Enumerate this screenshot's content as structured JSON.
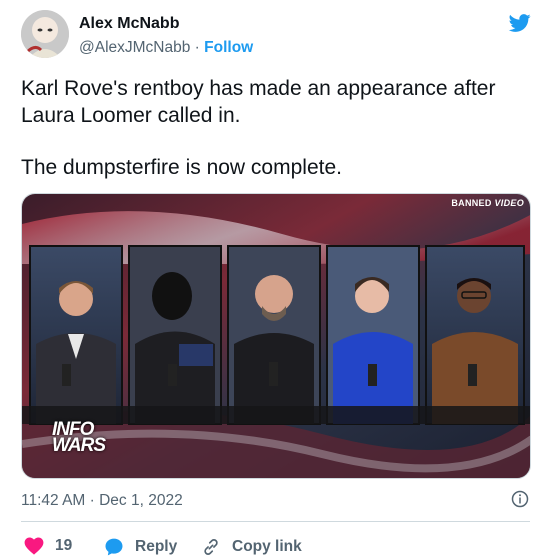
{
  "author": {
    "name": "Alex McNabb",
    "handle": "@AlexJMcNabb",
    "separator": " · ",
    "follow_label": "Follow"
  },
  "tweet": {
    "paragraphs": [
      "Karl Rove's rentboy has made an appearance after Laura Loomer called in.",
      "The dumpsterfire is now complete."
    ],
    "timestamp": "11:42 AM · Dec 1, 2022"
  },
  "media": {
    "watermark_main": "BANNED",
    "watermark_italic": "VIDEO",
    "logo_line1": "INFO",
    "logo_line2": "WARS"
  },
  "actions": {
    "like_count": "19",
    "reply_label": "Reply",
    "copy_link_label": "Copy link"
  },
  "colors": {
    "accent": "#1d9bf0",
    "like": "#f91880",
    "secondary_text": "#536471"
  },
  "icons": [
    "twitter-bird-icon",
    "info-icon",
    "heart-icon",
    "reply-bubble-icon",
    "link-icon"
  ]
}
